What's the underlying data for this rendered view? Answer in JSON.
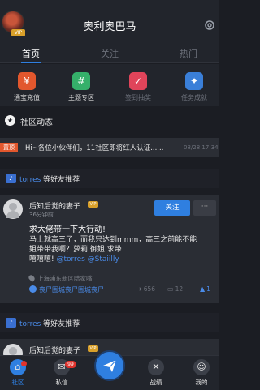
{
  "header": {
    "title": "奥利奥巴马",
    "vip_badge": "VIP"
  },
  "tabs": [
    {
      "label": "首页",
      "active": true
    },
    {
      "label": "关注",
      "active": false
    },
    {
      "label": "热门",
      "active": false
    }
  ],
  "quick_actions": [
    {
      "label": "通宝充值",
      "icon": "yuan-icon",
      "color": "#e2572d",
      "glyph": "¥"
    },
    {
      "label": "主题专区",
      "icon": "hashtag-icon",
      "color": "#35b06a",
      "glyph": "#"
    },
    {
      "label": "签到抽奖",
      "icon": "calendar-icon",
      "color": "#e0445a",
      "glyph": "✓"
    },
    {
      "label": "任务成就",
      "icon": "medal-icon",
      "color": "#3a7fd8",
      "glyph": "✦"
    }
  ],
  "community": {
    "title": "社区动态"
  },
  "notice": {
    "tag": "置顶",
    "text": "Hi~各位小伙伴们，11社区即将红人认证......",
    "time": "08/28 17:34"
  },
  "recommendations": [
    {
      "site": "torres",
      "text": " 等好友推荐"
    },
    {
      "site": "torres",
      "text": " 等好友推荐"
    }
  ],
  "posts": [
    {
      "author": "后知后觉的妻子",
      "vip": "VIP",
      "time": "36分钟前",
      "follow_label": "关注",
      "more_label": "···",
      "title": "求大佬带一下大行动!",
      "body_line1": "马上就高三了，而我只达到mmm，高三之前能不能",
      "body_line2": "姐带带我啊？萝莉 御姐 求带!",
      "body_prefix": "嘻嘻嘻! ",
      "mention1": "@torres",
      "mention2": "@Staiilly",
      "location": "上海浦东新区陆家嘴",
      "group": "丧尸围城丧尸围城丧尸",
      "views": "656",
      "comments": "12",
      "likes": "1"
    },
    {
      "author": "后知后觉的妻子",
      "vip": "VIP"
    }
  ],
  "bottom_nav": {
    "community_label": "社区",
    "messages_label": "私信",
    "messages_badge": "99",
    "battle_label": "战绩",
    "me_label": "我的"
  },
  "colors": {
    "accent": "#2f7fe0",
    "background": "#1b1d23",
    "card": "#2a2d34",
    "notice_tag": "#e2572d"
  }
}
